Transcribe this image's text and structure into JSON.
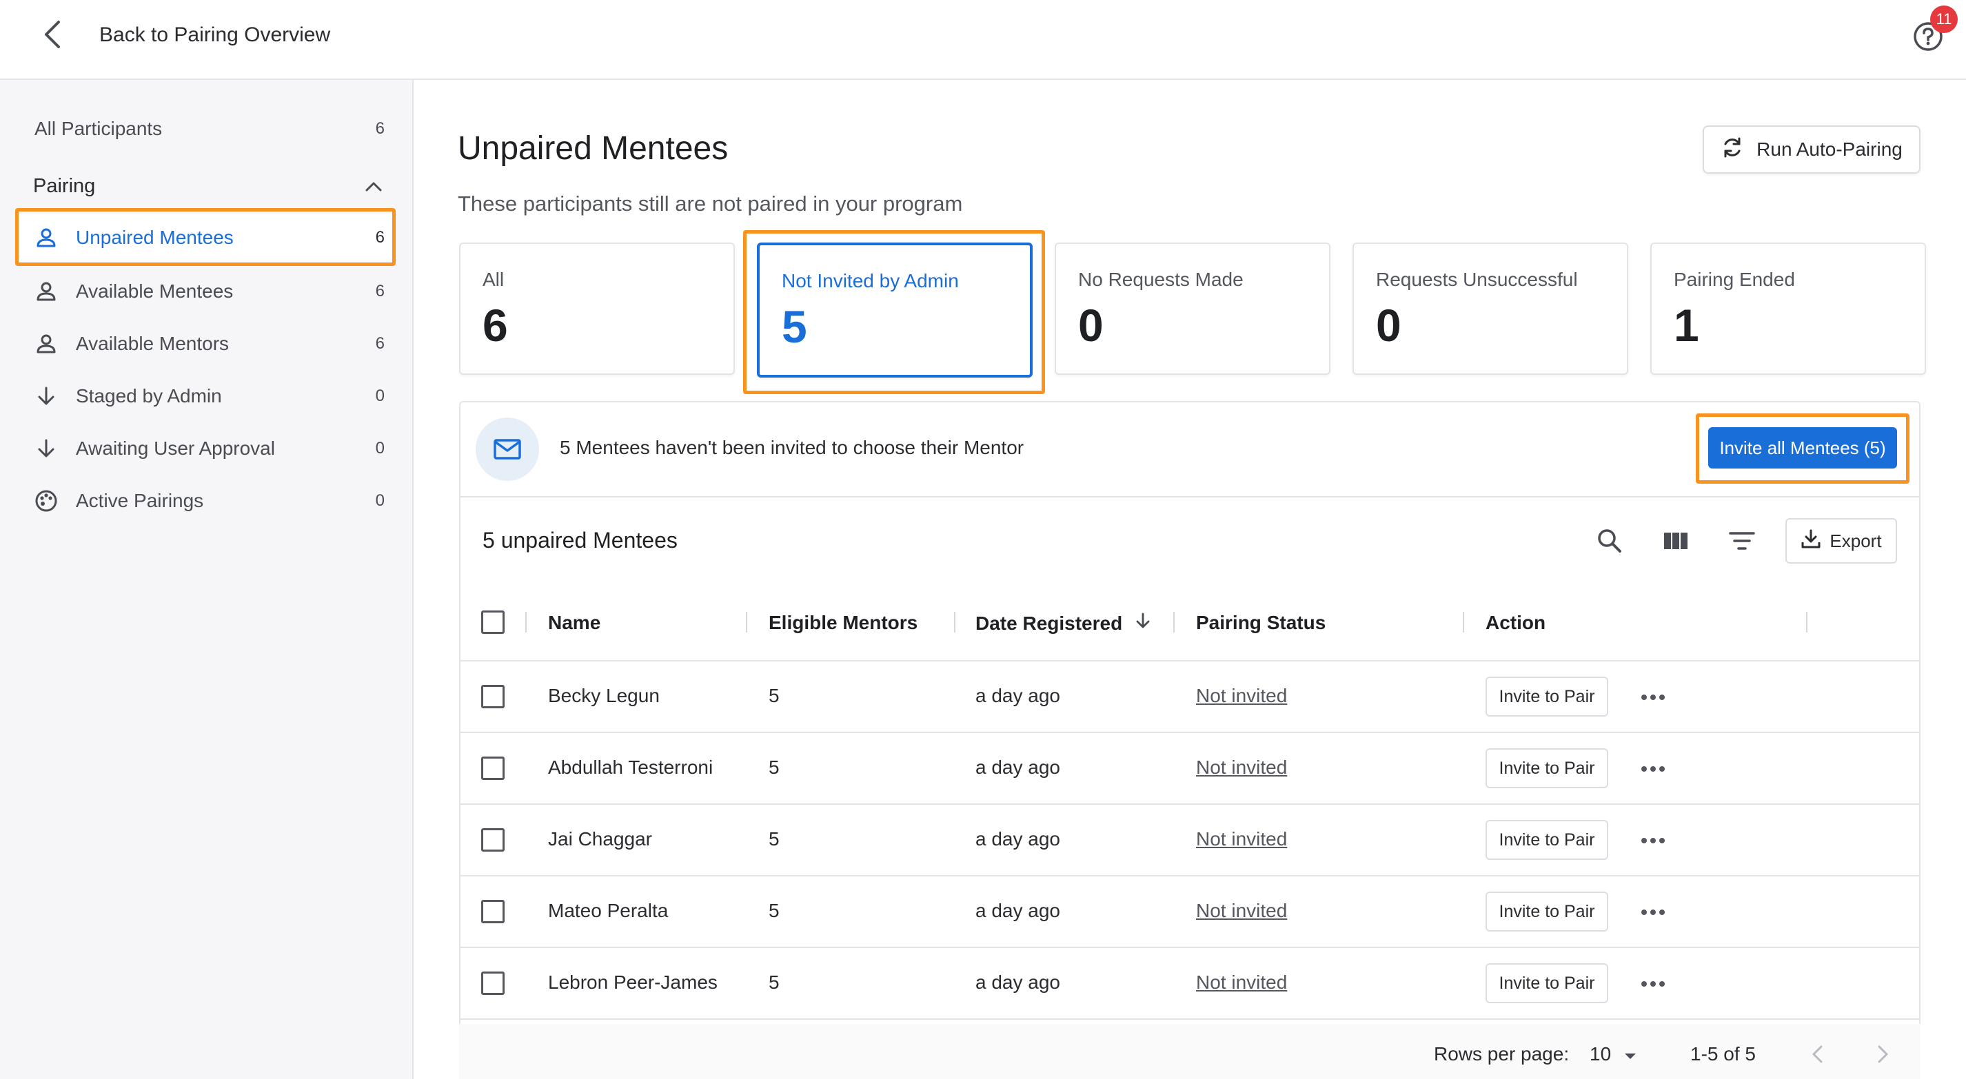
{
  "header": {
    "back_label": "Back to Pairing Overview",
    "help_badge": "11",
    "back_icon": "chevron-left-icon",
    "help_icon": "question-circle-icon"
  },
  "sidebar": {
    "all_participants": {
      "label": "All Participants",
      "count": "6"
    },
    "section_label": "Pairing",
    "items": [
      {
        "label": "Unpaired Mentees",
        "count": "6",
        "icon": "person-icon",
        "active": true
      },
      {
        "label": "Available Mentees",
        "count": "6",
        "icon": "person-icon"
      },
      {
        "label": "Available Mentors",
        "count": "6",
        "icon": "person-icon"
      },
      {
        "label": "Staged by Admin",
        "count": "0",
        "icon": "arrow-down-icon"
      },
      {
        "label": "Awaiting User Approval",
        "count": "0",
        "icon": "arrow-down-icon"
      },
      {
        "label": "Active Pairings",
        "count": "0",
        "icon": "palette-icon"
      }
    ]
  },
  "main": {
    "title": "Unpaired Mentees",
    "subtitle": "These participants still are not paired in your program",
    "auto_pairing_label": "Run Auto-Pairing",
    "stats": [
      {
        "label": "All",
        "value": "6"
      },
      {
        "label": "Not Invited by Admin",
        "value": "5",
        "selected": true
      },
      {
        "label": "No Requests Made",
        "value": "0"
      },
      {
        "label": "Requests Unsuccessful",
        "value": "0"
      },
      {
        "label": "Pairing Ended",
        "value": "1"
      }
    ],
    "notice_text": "5 Mentees haven't been invited to choose their Mentor",
    "invite_all_label": "Invite all Mentees (5)"
  },
  "table": {
    "title": "5 unpaired Mentees",
    "export_label": "Export",
    "columns": [
      "Name",
      "Eligible Mentors",
      "Date Registered",
      "Pairing Status",
      "Action"
    ],
    "rows": [
      {
        "name": "Becky Legun",
        "eligible": "5",
        "date": "a day ago",
        "status": "Not invited",
        "action": "Invite to Pair"
      },
      {
        "name": "Abdullah Testerroni",
        "eligible": "5",
        "date": "a day ago",
        "status": "Not invited",
        "action": "Invite to Pair"
      },
      {
        "name": "Jai Chaggar",
        "eligible": "5",
        "date": "a day ago",
        "status": "Not invited",
        "action": "Invite to Pair"
      },
      {
        "name": "Mateo Peralta",
        "eligible": "5",
        "date": "a day ago",
        "status": "Not invited",
        "action": "Invite to Pair"
      },
      {
        "name": "Lebron Peer-James",
        "eligible": "5",
        "date": "a day ago",
        "status": "Not invited",
        "action": "Invite to Pair"
      }
    ],
    "footer": {
      "rows_per_page_label": "Rows per page:",
      "rows_per_page_value": "10",
      "range": "1-5 of 5"
    }
  },
  "colors": {
    "accent": "#1a6ed8",
    "highlight": "#f7931e",
    "badge": "#e5393d"
  }
}
